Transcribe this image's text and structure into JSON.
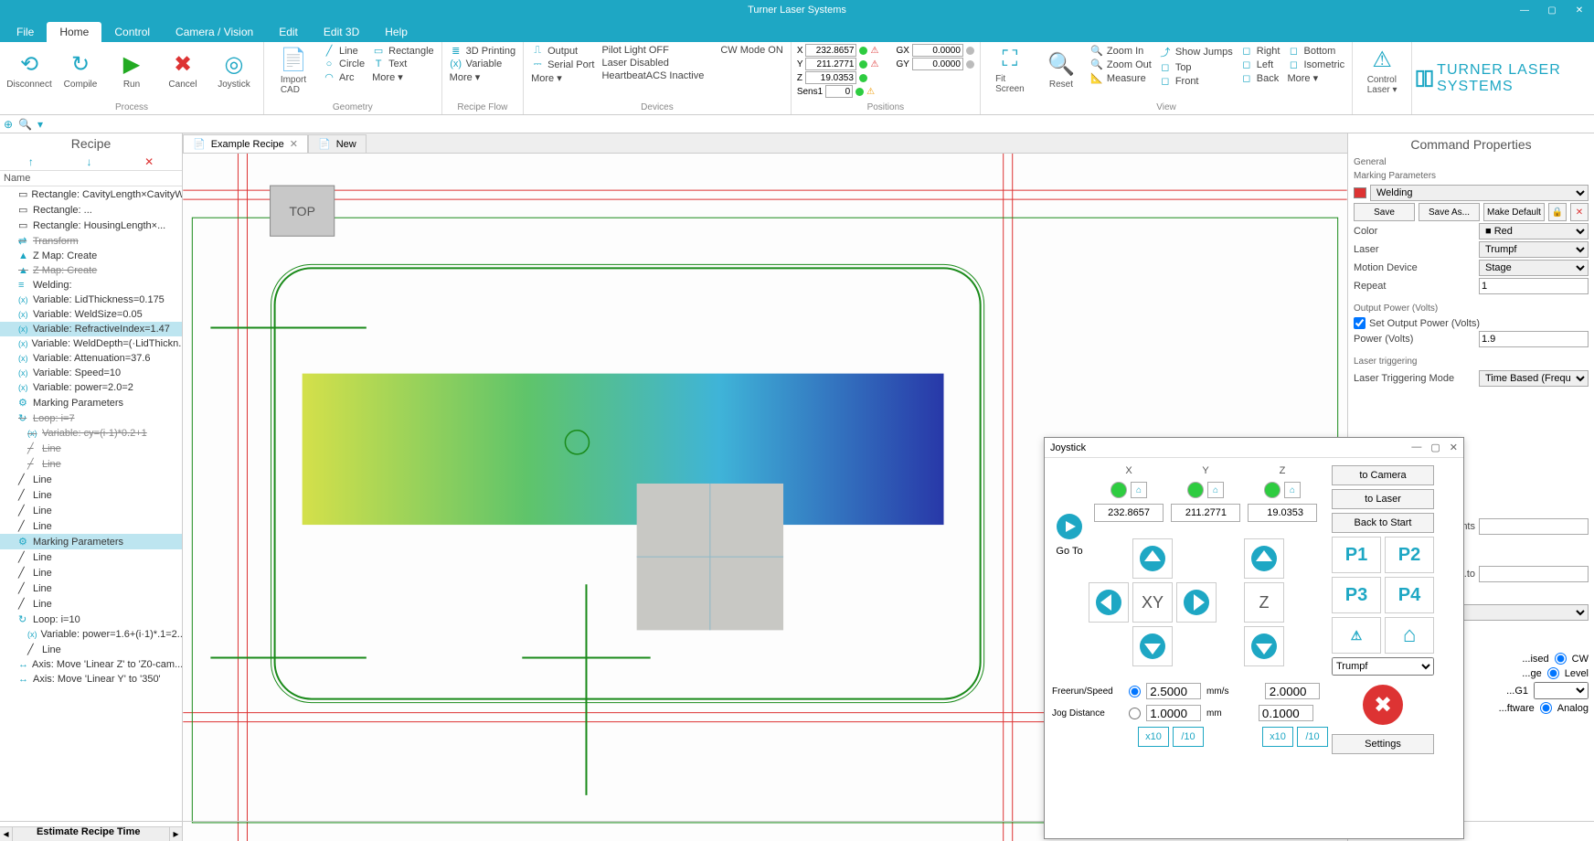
{
  "app_title": "Turner Laser Systems",
  "menu_tabs": [
    "File",
    "Home",
    "Control",
    "Camera / Vision",
    "Edit",
    "Edit 3D",
    "Help"
  ],
  "active_menu": 1,
  "ribbon": {
    "process": {
      "label": "Process",
      "buttons": [
        {
          "label": "Disconnect",
          "icon": "⟳"
        },
        {
          "label": "Compile",
          "icon": "↻"
        },
        {
          "label": "Run",
          "icon": "▶"
        },
        {
          "label": "Cancel",
          "icon": "✖"
        },
        {
          "label": "Joystick",
          "icon": "◎"
        }
      ]
    },
    "import_cad": "Import\nCAD",
    "geometry": {
      "label": "Geometry",
      "items": [
        "Line",
        "Rectangle",
        "Circle",
        "Text",
        "Arc",
        "More ▾"
      ]
    },
    "recipe_flow": {
      "label": "Recipe Flow",
      "items": [
        "3D Printing",
        "Variable",
        "More ▾"
      ]
    },
    "devices": {
      "label": "Devices",
      "items_left": [
        "Output",
        "Serial Port",
        "More ▾"
      ],
      "items_right": [
        "Pilot Light OFF",
        "Laser Disabled",
        "HeartbeatACS Inactive"
      ],
      "cw_mode": "CW Mode ON"
    },
    "positions": {
      "label": "Positions",
      "rows": [
        {
          "axis": "X",
          "val": "232.8657",
          "g": "GX",
          "gval": "0.0000"
        },
        {
          "axis": "Y",
          "val": "211.2771",
          "g": "GY",
          "gval": "0.0000"
        },
        {
          "axis": "Z",
          "val": "19.0353"
        },
        {
          "axis": "Sens1",
          "val": "0"
        }
      ]
    },
    "fit_screen": "Fit\nScreen",
    "reset": "Reset",
    "view": {
      "label": "View",
      "col1": [
        "Zoom In",
        "Zoom Out",
        "Measure"
      ],
      "col2": [
        "Show Jumps",
        "Top",
        "Front"
      ],
      "col3": [
        "Right",
        "Left",
        "Back"
      ],
      "col4": [
        "Bottom",
        "Isometric",
        "More ▾"
      ]
    },
    "control_laser": "Control\nLaser ▾",
    "brand": "TURNER LASER SYSTEMS"
  },
  "doc_tabs": [
    {
      "label": "Example Recipe",
      "active": true
    },
    {
      "label": "New",
      "active": false
    }
  ],
  "recipe": {
    "title": "Recipe",
    "name_hdr": "Name",
    "items": [
      {
        "t": "Rectangle: CavityLength×CavityW",
        "ind": 0
      },
      {
        "t": "Rectangle: ...",
        "ind": 0
      },
      {
        "t": "Rectangle: HousingLength×...",
        "ind": 0
      },
      {
        "t": "Transform",
        "ind": 0,
        "strike": true
      },
      {
        "t": "Z Map: Create",
        "ind": 0
      },
      {
        "t": "Z Map: Create",
        "ind": 0,
        "strike": true
      },
      {
        "t": "Welding:",
        "ind": 0
      },
      {
        "t": "Variable: LidThickness=0.175",
        "ind": 0
      },
      {
        "t": "Variable: WeldSize=0.05",
        "ind": 0
      },
      {
        "t": "Variable: RefractiveIndex=1.47",
        "ind": 0,
        "sel": true
      },
      {
        "t": "Variable: WeldDepth=(·LidThickn...",
        "ind": 0
      },
      {
        "t": "Variable: Attenuation=37.6",
        "ind": 0
      },
      {
        "t": "Variable: Speed=10",
        "ind": 0
      },
      {
        "t": "Variable: power=2.0=2",
        "ind": 0
      },
      {
        "t": "Marking Parameters",
        "ind": 0,
        "icon": "gear"
      },
      {
        "t": "Loop: i=7",
        "ind": 0,
        "strike": true,
        "arrow": true
      },
      {
        "t": "Variable: cy=(i·1)*0.2+1",
        "ind": 1,
        "strike": true
      },
      {
        "t": "Line",
        "ind": 1,
        "strike": true
      },
      {
        "t": "Line",
        "ind": 1,
        "strike": true
      },
      {
        "t": "Line",
        "ind": 0
      },
      {
        "t": "Line",
        "ind": 0
      },
      {
        "t": "Line",
        "ind": 0
      },
      {
        "t": "Line",
        "ind": 0
      },
      {
        "t": "Marking Parameters",
        "ind": 0,
        "icon": "gear",
        "sel": true
      },
      {
        "t": "Line",
        "ind": 0
      },
      {
        "t": "Line",
        "ind": 0
      },
      {
        "t": "Line",
        "ind": 0
      },
      {
        "t": "Line",
        "ind": 0
      },
      {
        "t": "Loop: i=10",
        "ind": 0,
        "arrow": true
      },
      {
        "t": "Variable: power=1.6+(i·1)*.1=2...",
        "ind": 1
      },
      {
        "t": "Line",
        "ind": 1
      },
      {
        "t": "Axis: Move 'Linear Z' to 'Z0-cam...'",
        "ind": 0
      },
      {
        "t": "Axis: Move 'Linear Y' to '350'",
        "ind": 0
      }
    ]
  },
  "canvas": {
    "top_label": "TOP"
  },
  "props": {
    "title": "Command Properties",
    "general": "General",
    "marking_params": "Marking Parameters",
    "preset": "Welding",
    "save": "Save",
    "save_as": "Save As...",
    "make_default": "Make Default",
    "color_label": "Color",
    "color_value": "Red",
    "laser_label": "Laser",
    "laser_value": "Trumpf",
    "motion_label": "Motion Device",
    "motion_value": "Stage",
    "repeat_label": "Repeat",
    "repeat_value": "1",
    "output_power_section": "Output Power (Volts)",
    "set_output_power": "Set Output Power (Volts)",
    "power_label": "Power (Volts)",
    "power_value": "1.9",
    "laser_trig_section": "Laser triggering",
    "trig_mode_label": "Laser Triggering Mode",
    "trig_mode_value": "Time Based (Frequency Dr",
    "extra_rows": [
      "...ents",
      "...to"
    ],
    "radio_rows": [
      {
        "label": "...ised",
        "opt": "CW"
      },
      {
        "label": "...ge",
        "opt": "Level"
      },
      {
        "label": "...G1",
        "opt": ""
      },
      {
        "label": "...ftware",
        "opt": "Analog"
      }
    ]
  },
  "joystick": {
    "title": "Joystick",
    "axes": [
      "X",
      "Y",
      "Z"
    ],
    "coords": [
      "232.8657",
      "211.2771",
      "19.0353"
    ],
    "goto": "Go To",
    "xy": "XY",
    "z": "Z",
    "freerun": "Freerun/Speed",
    "jog": "Jog Distance",
    "speed_xy": "2.5000",
    "jog_xy": "1.0000",
    "speed_z": "2.0000",
    "jog_z": "0.1000",
    "unit_speed": "mm/s",
    "unit_jog": "mm",
    "x10": "x10",
    "d10": "/10",
    "to_camera": "to Camera",
    "to_laser": "to Laser",
    "back_start": "Back to Start",
    "p": [
      "P1",
      "P2",
      "P3",
      "P4"
    ],
    "trumpf": "Trumpf",
    "settings": "Settings"
  },
  "footer": {
    "estimate": "Estimate Recipe Time"
  }
}
